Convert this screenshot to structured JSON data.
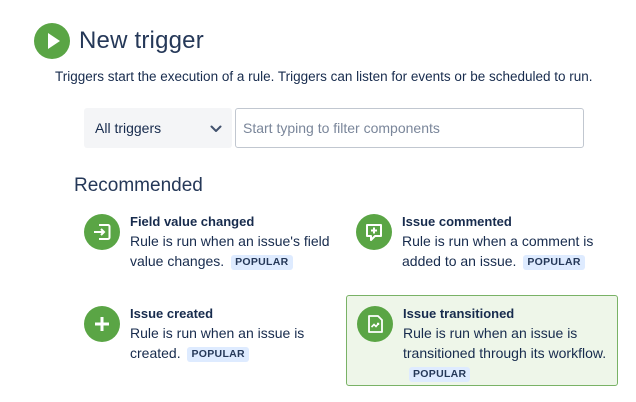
{
  "header": {
    "title": "New trigger",
    "subtitle": "Triggers start the execution of a rule. Triggers can listen for events or be scheduled to run."
  },
  "filter": {
    "select_value": "All triggers",
    "search_placeholder": "Start typing to filter components"
  },
  "section": {
    "heading": "Recommended"
  },
  "triggers": [
    {
      "title": "Field value changed",
      "description": "Rule is run when an issue's field value changes.",
      "badge": "POPULAR",
      "icon": "field-change-icon"
    },
    {
      "title": "Issue commented",
      "description": "Rule is run when a comment is added to an issue.",
      "badge": "POPULAR",
      "icon": "comment-add-icon"
    },
    {
      "title": "Issue created",
      "description": "Rule is run when an issue is created.",
      "badge": "POPULAR",
      "icon": "plus-icon"
    },
    {
      "title": "Issue transitioned",
      "description": "Rule is run when an issue is transitioned through its workflow.",
      "badge": "POPULAR",
      "icon": "transition-icon",
      "selected": true
    }
  ],
  "colors": {
    "accent_green": "#5aa545",
    "badge_bg": "#deebff",
    "selected_bg": "#eef6e9",
    "selected_border": "#79b266"
  }
}
